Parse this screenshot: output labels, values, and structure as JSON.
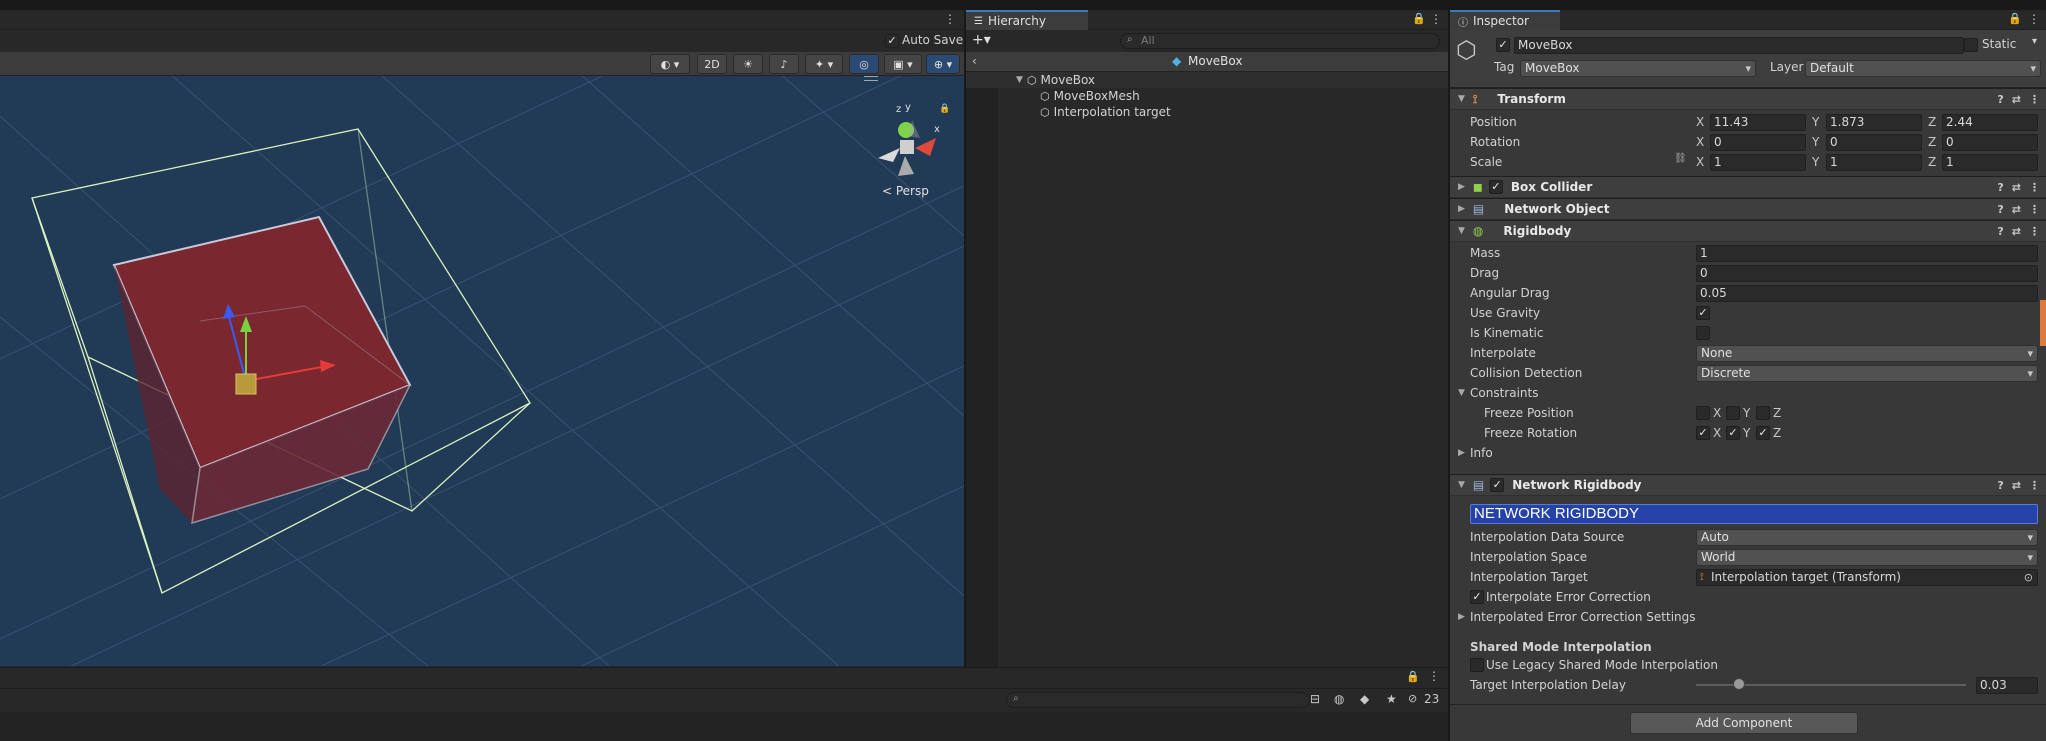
{
  "scene": {
    "auto_save_label": "Auto Save",
    "toolbar": {
      "btn_2d": "2D"
    },
    "gizmo": {
      "y_label": "y",
      "z_label": "z",
      "x_label": "x",
      "persp_label": "< Persp"
    }
  },
  "hierarchy": {
    "tab_label": "Hierarchy",
    "search_placeholder": "All",
    "scene_title": "MoveBox",
    "items": [
      {
        "label": "MoveBox"
      },
      {
        "label": "MoveBoxMesh"
      },
      {
        "label": "Interpolation target"
      }
    ]
  },
  "inspector": {
    "tab_label": "Inspector",
    "object_name": "MoveBox",
    "static_label": "Static",
    "tag_label": "Tag",
    "tag_value": "MoveBox",
    "layer_label": "Layer",
    "layer_value": "Default",
    "transform": {
      "title": "Transform",
      "position_label": "Position",
      "rotation_label": "Rotation",
      "scale_label": "Scale",
      "axes": {
        "x": "X",
        "y": "Y",
        "z": "Z"
      },
      "position": {
        "x": "11.43",
        "y": "1.873",
        "z": "2.44"
      },
      "rotation": {
        "x": "0",
        "y": "0",
        "z": "0"
      },
      "scale": {
        "x": "1",
        "y": "1",
        "z": "1"
      }
    },
    "box_collider": {
      "title": "Box Collider"
    },
    "network_object": {
      "title": "Network Object"
    },
    "rigidbody": {
      "title": "Rigidbody",
      "mass_label": "Mass",
      "mass": "1",
      "drag_label": "Drag",
      "drag": "0",
      "angular_drag_label": "Angular Drag",
      "angular_drag": "0.05",
      "use_gravity_label": "Use Gravity",
      "is_kinematic_label": "Is Kinematic",
      "interpolate_label": "Interpolate",
      "interpolate": "None",
      "collision_label": "Collision Detection",
      "collision": "Discrete",
      "constraints_label": "Constraints",
      "freeze_position_label": "Freeze Position",
      "freeze_rotation_label": "Freeze Rotation",
      "info_label": "Info"
    },
    "network_rigidbody": {
      "title": "Network Rigidbody",
      "banner": "NETWORK RIGIDBODY",
      "data_source_label": "Interpolation Data Source",
      "data_source": "Auto",
      "space_label": "Interpolation Space",
      "space": "World",
      "target_label": "Interpolation Target",
      "target": "Interpolation target (Transform)",
      "error_correction_label": "Interpolate Error Correction",
      "error_settings_label": "Interpolated Error Correction Settings",
      "shared_mode_heading": "Shared Mode Interpolation",
      "legacy_label": "Use Legacy Shared Mode Interpolation",
      "delay_label": "Target Interpolation Delay",
      "delay": "0.03",
      "delay_fraction": 0.16
    },
    "add_component": "Add Component"
  },
  "bottom": {
    "count": "23"
  },
  "colors": {
    "accent": "#3a79bb",
    "scene_bg": "#213a55",
    "banner": "#2542a8"
  }
}
